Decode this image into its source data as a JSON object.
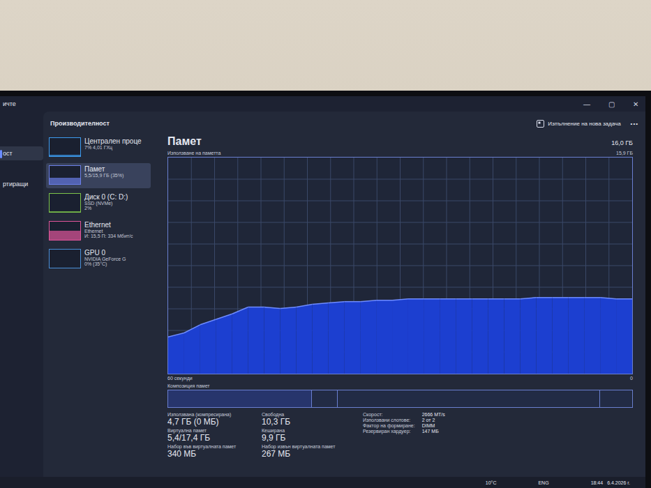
{
  "screen_title": "ичте",
  "window_controls": [
    "—",
    "▢",
    "✕"
  ],
  "nav": [
    {
      "label": "ост",
      "selected": true
    },
    {
      "label": "ртиращи",
      "selected": false
    }
  ],
  "header": {
    "title": "Производителност",
    "run_task": "Изпълнение на нова задача",
    "more": "•••"
  },
  "devices": [
    {
      "name": "Централен проце",
      "details": [
        "7% 4,01 ГХц"
      ],
      "selected": false,
      "level": 0.07,
      "color": "#3d9cf0"
    },
    {
      "name": "Памет",
      "details": [
        "5,5/15,9 ГБ (35%)"
      ],
      "selected": true,
      "level": 0.35,
      "color": "#6b7fe8"
    },
    {
      "name": "Диск 0 (C: D:)",
      "details": [
        "SSD (NVMe)",
        "2%"
      ],
      "selected": false,
      "level": 0.02,
      "color": "#7cc44a"
    },
    {
      "name": "Ethernet",
      "details": [
        "Ethernet",
        "И: 15,5 П: 334 Мбит/с"
      ],
      "selected": false,
      "level": 0.5,
      "color": "#e0559a"
    },
    {
      "name": "GPU 0",
      "details": [
        "NVIDIA GeForce G",
        "0% (35°C)"
      ],
      "selected": false,
      "level": 0.0,
      "color": "#4a8fd8"
    }
  ],
  "detail": {
    "title": "Памет",
    "capacity": "16,0 ГБ",
    "chart_label": "Използване на паметта",
    "axis_max": "15,9 ГБ",
    "time_label": "60 секунди",
    "axis_min": "0",
    "max_value": 15.9,
    "series": [
      2.7,
      3.0,
      3.6,
      4.0,
      4.4,
      4.9,
      4.9,
      4.8,
      4.9,
      5.1,
      5.2,
      5.3,
      5.3,
      5.4,
      5.4,
      5.5,
      5.5,
      5.5,
      5.5,
      5.5,
      5.5,
      5.5,
      5.5,
      5.6,
      5.6,
      5.6,
      5.6,
      5.6,
      5.5,
      5.5
    ]
  },
  "composition": {
    "label": "Композиция памет",
    "segments": [
      {
        "level": 0.31
      },
      {
        "level": 0.054
      },
      {
        "level": 0.566
      },
      {
        "level": 0.069
      }
    ]
  },
  "stats": [
    {
      "label": "Използвана (компресирана)",
      "value": "4,7 ГБ (0 МБ)"
    },
    {
      "label": "Свободна",
      "value": "10,3 ГБ"
    },
    {
      "label": "Виртуална памет",
      "value": "5,4/17,4 ГБ"
    },
    {
      "label": "Кеширана",
      "value": "9,9 ГБ"
    },
    {
      "label": "Набор във виртуалната памет",
      "value": "340 МБ"
    },
    {
      "label": "Набор извън виртуалната памет",
      "value": "267 МБ"
    }
  ],
  "specs": [
    {
      "label": "Скорост:",
      "value": "2666 MT/s"
    },
    {
      "label": "Използвани слотове:",
      "value": "2 от 2"
    },
    {
      "label": "Фактор на формиране:",
      "value": "DIMM"
    },
    {
      "label": "Резервиран хардуер:",
      "value": "147 МБ"
    }
  ],
  "taskbar": {
    "weather": "10°C",
    "language": "ENG",
    "time": "18:44",
    "date": "6.4.2026 г."
  }
}
